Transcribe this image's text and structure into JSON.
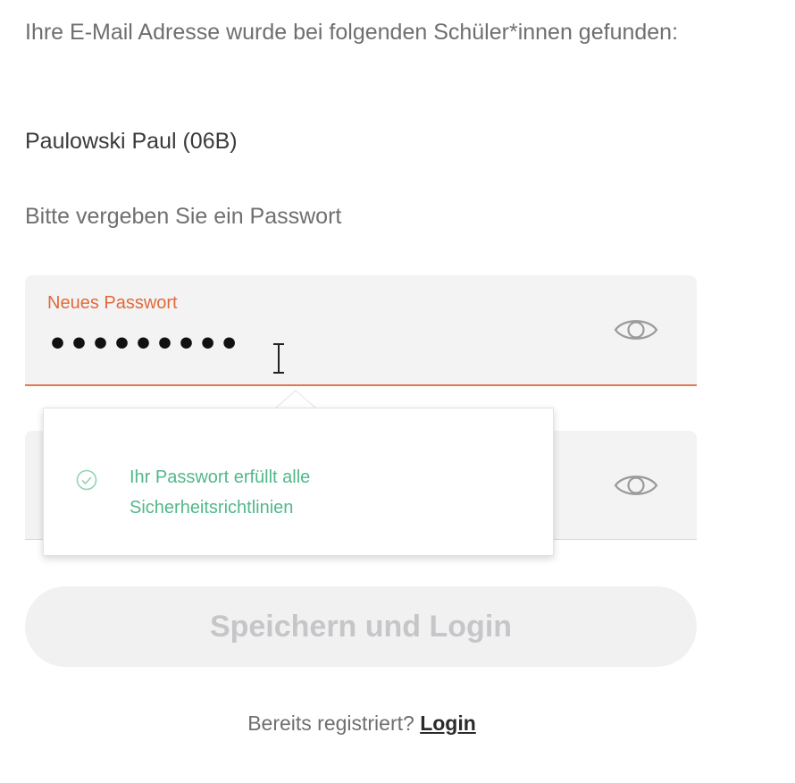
{
  "intro_text": "Ihre E-Mail Adresse wurde bei folgenden Schüler*innen gefunden:",
  "student_name": "Paulowski Paul (06B)",
  "password_prompt": "Bitte vergeben Sie ein Passwort",
  "new_password": {
    "label": "Neues Passwort",
    "value_masked": "•••••••••",
    "toggle_icon": "eye-icon"
  },
  "confirm_password": {
    "toggle_icon": "eye-icon"
  },
  "password_popover": {
    "status_icon": "check-circle-icon",
    "message": "Ihr Passwort erfüllt alle Sicherheitsrichtlinien"
  },
  "submit_button": {
    "label": "Speichern und Login",
    "disabled": true
  },
  "footer": {
    "prompt": "Bereits registriert?",
    "login_link": "Login"
  },
  "colors": {
    "accent": "#e06a3a",
    "success": "#52b88a",
    "text_muted": "#6f6f6f",
    "field_bg": "#f3f3f4"
  }
}
